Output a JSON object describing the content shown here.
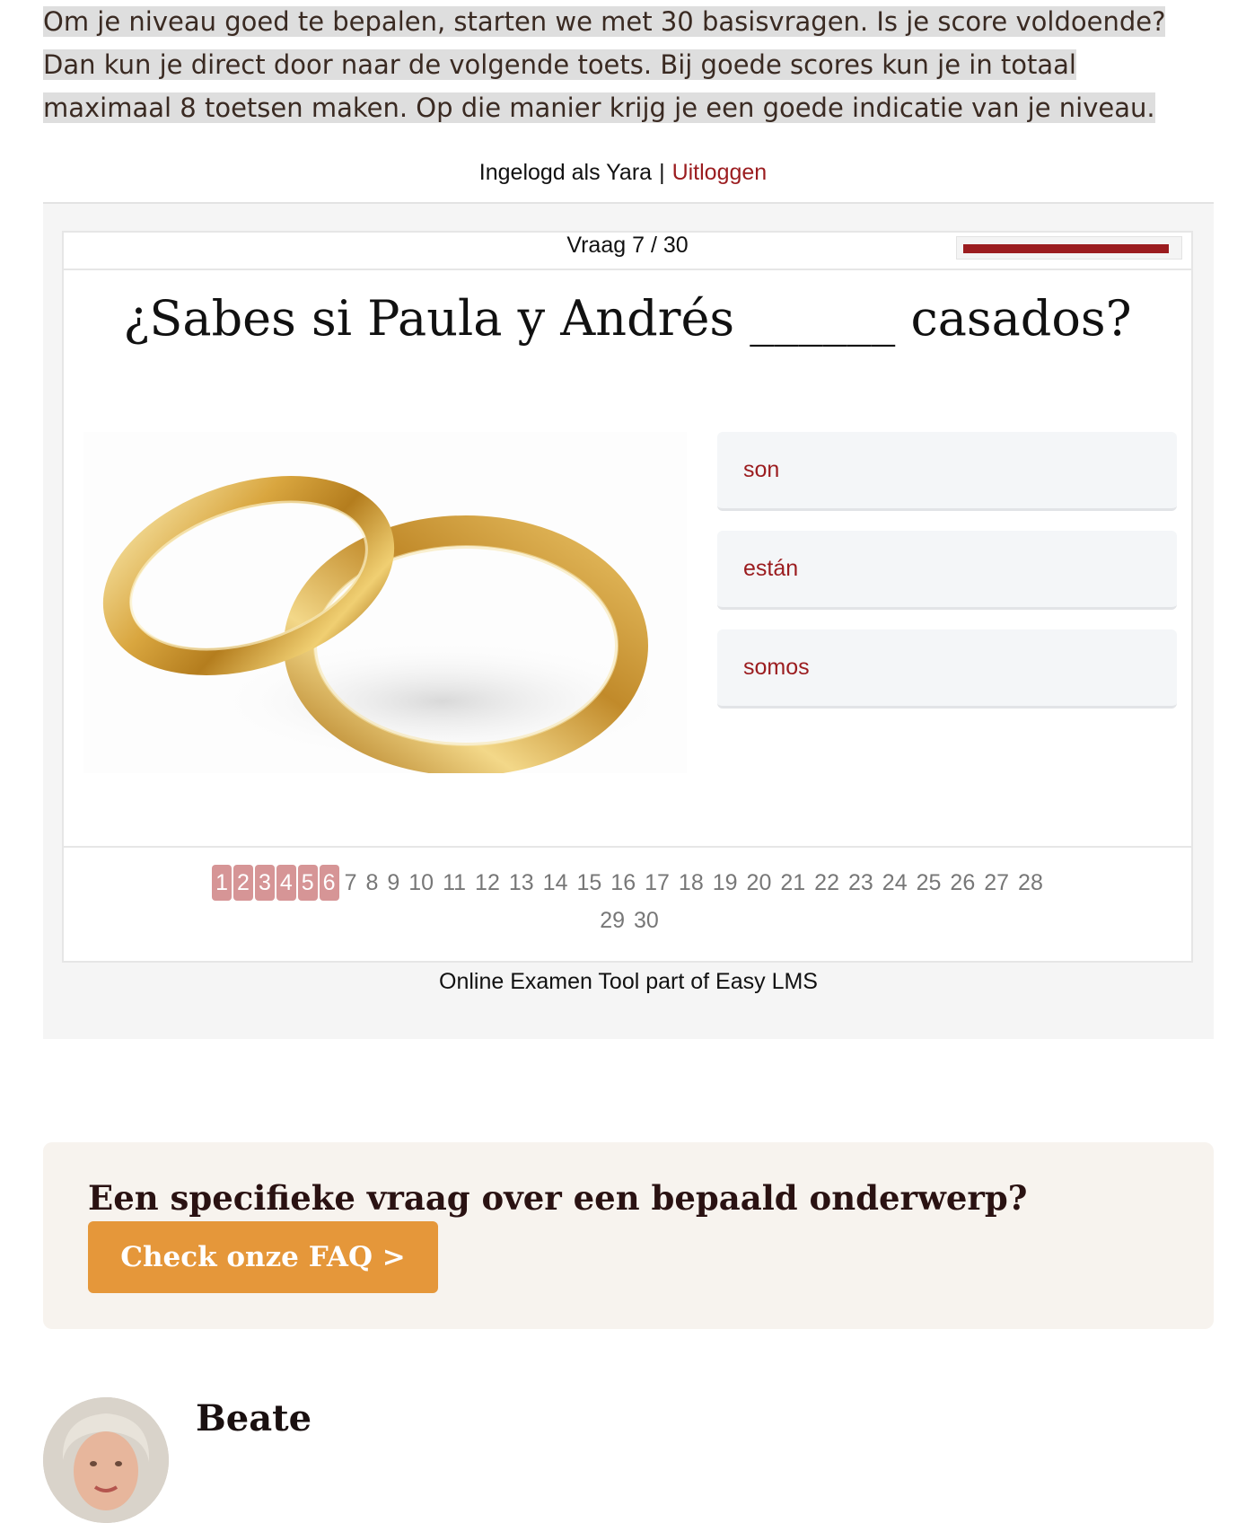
{
  "intro": {
    "text": "Om je niveau goed te bepalen, starten we met 30 basisvragen. Is je score voldoende? Dan kun je direct door naar de volgende toets. Bij goede scores kun je in totaal maximaal 8 toetsen maken. Op die manier krijg je een goede indicatie van je niveau."
  },
  "login": {
    "prefix": "Ingelogd als Yara",
    "separator": "|",
    "logout_label": "Uitloggen"
  },
  "exam": {
    "counter": "Vraag 7 / 30",
    "progress_fraction": 0.97,
    "question": "¿Sabes si Paula y Andrés ______ casados?",
    "image_icon": "wedding-rings-image",
    "answers": [
      "son",
      "están",
      "somos"
    ],
    "completed_pages": [
      "1",
      "2",
      "3",
      "4",
      "5",
      "6"
    ],
    "pages": [
      "7",
      "8",
      "9",
      "10",
      "11",
      "12",
      "13",
      "14",
      "15",
      "16",
      "17",
      "18",
      "19",
      "20",
      "21",
      "22",
      "23",
      "24",
      "25",
      "26",
      "27",
      "28",
      "29",
      "30"
    ],
    "powered_by": "Online Examen Tool part of Easy LMS"
  },
  "faq": {
    "title": "Een specifieke vraag over een bepaald onderwerp?",
    "button_label": "Check onze FAQ >"
  },
  "author": {
    "name": "Beate",
    "avatar_icon": "author-photo"
  },
  "colors": {
    "accent": "#9b1c1f",
    "done_page": "#d69596",
    "faq_button": "#e5973a",
    "faq_bg": "#f7f3ee"
  }
}
